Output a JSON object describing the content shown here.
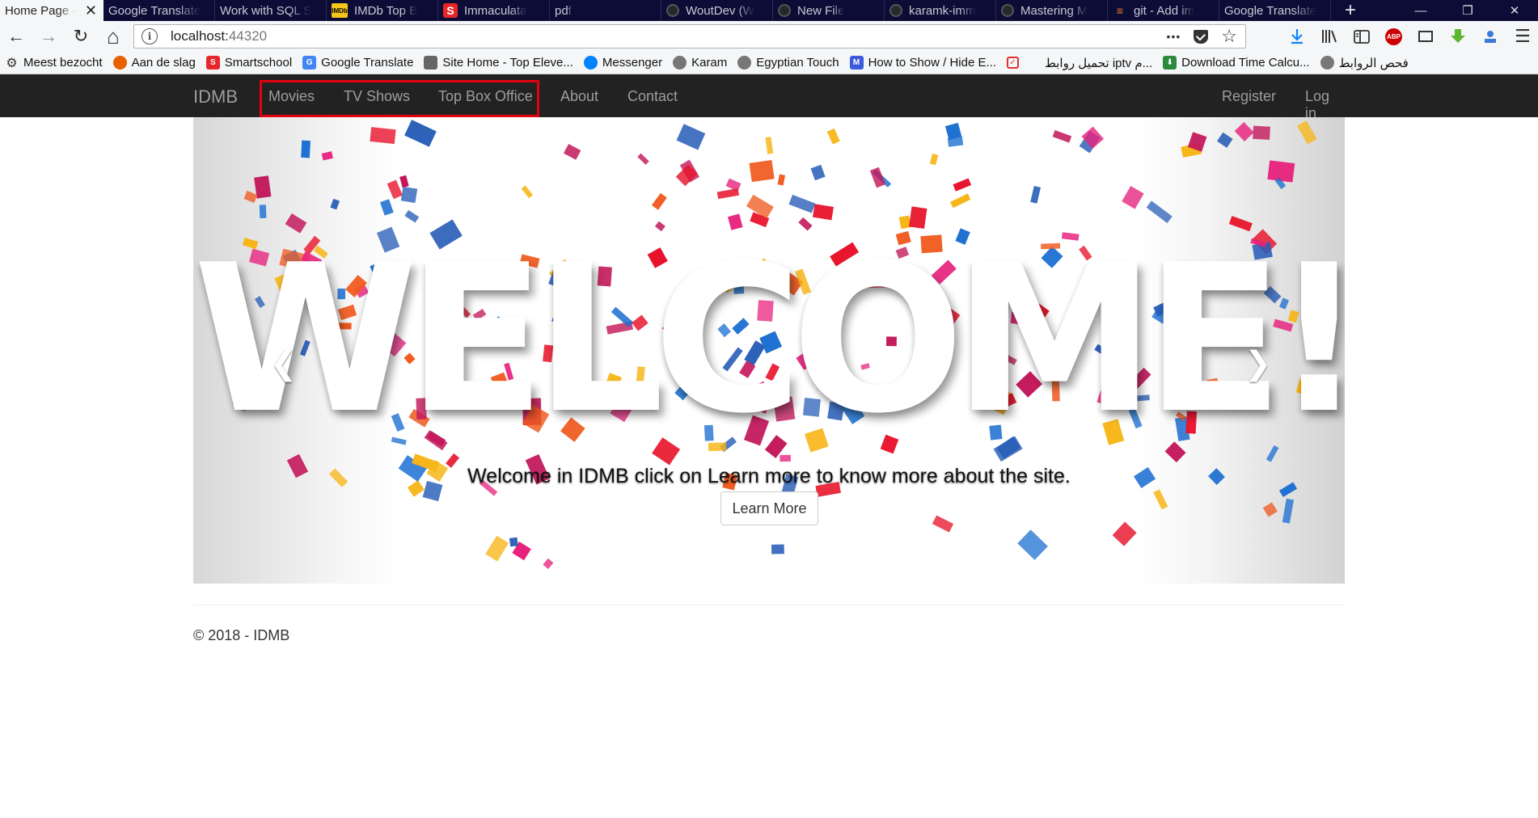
{
  "browser": {
    "tabs": [
      {
        "label": "Home Page - ",
        "icon": "none",
        "active": true
      },
      {
        "label": "Google Translate",
        "icon": "none"
      },
      {
        "label": "Work with SQL S",
        "icon": "none"
      },
      {
        "label": "IMDb Top B",
        "icon": "imdb",
        "icon_text": "IMDb"
      },
      {
        "label": "Immaculata",
        "icon": "smart",
        "icon_text": "S"
      },
      {
        "label": "pdf",
        "icon": "none"
      },
      {
        "label": "WoutDev (W",
        "icon": "gh"
      },
      {
        "label": "New File",
        "icon": "gh"
      },
      {
        "label": "karamk-imm",
        "icon": "gh"
      },
      {
        "label": "Mastering M",
        "icon": "gh"
      },
      {
        "label": "git - Add im",
        "icon": "so",
        "icon_text": "≡"
      },
      {
        "label": "Google Translate",
        "icon": "none"
      }
    ],
    "close_tab_glyph": "✕",
    "new_tab_glyph": "+",
    "window_controls": {
      "minimize": "—",
      "restore": "❐",
      "close": "✕"
    },
    "toolbar": {
      "back": "←",
      "forward": "→",
      "reload": "↻",
      "home": "⌂",
      "url_host": "localhost:",
      "url_port": "44320",
      "more": "•••",
      "star": "☆"
    },
    "bookmarks": [
      {
        "label": "Meest bezocht",
        "icon": "gear-icon",
        "color": "#333333",
        "glyph": "⚙"
      },
      {
        "label": "Aan de slag",
        "icon": "firefox-icon",
        "color": "#e66000",
        "glyph": ""
      },
      {
        "label": "Smartschool",
        "icon": "smartschool-icon",
        "color": "#e8262a",
        "glyph": "S"
      },
      {
        "label": "Google Translate",
        "icon": "translate-icon",
        "color": "#4285f4",
        "glyph": "G"
      },
      {
        "label": "Site Home - Top Eleve...",
        "icon": "site-icon",
        "color": "#666666",
        "glyph": ""
      },
      {
        "label": "Messenger",
        "icon": "messenger-icon",
        "color": "#0084ff",
        "glyph": ""
      },
      {
        "label": "Karam",
        "icon": "globe-icon",
        "color": "#777777",
        "glyph": ""
      },
      {
        "label": "Egyptian Touch",
        "icon": "globe-icon",
        "color": "#777777",
        "glyph": ""
      },
      {
        "label": "How to Show / Hide E...",
        "icon": "m-icon",
        "color": "#3b5bdb",
        "glyph": "M"
      },
      {
        "label": "",
        "icon": "checklist-icon",
        "color": "#e03131",
        "glyph": "✓"
      },
      {
        "label": "تحميل روابط iptv م...",
        "icon": "none",
        "color": "transparent",
        "glyph": ""
      },
      {
        "label": "Download Time Calcu...",
        "icon": "download-icon",
        "color": "#2b8a3e",
        "glyph": "⬇"
      },
      {
        "label": "فحص الروابط",
        "icon": "globe-icon",
        "color": "#777777",
        "glyph": ""
      }
    ]
  },
  "site": {
    "brand": "IDMB",
    "nav": {
      "movies": "Movies",
      "tv_shows": "TV Shows",
      "top_box_office": "Top Box Office",
      "about": "About",
      "contact": "Contact",
      "register": "Register",
      "login": "Log in"
    },
    "carousel": {
      "image_text": "WELCOME!",
      "caption": "Welcome in IDMB click on Learn more to know more about the site.",
      "button": "Learn More",
      "prev_glyph": "❮",
      "next_glyph": "❯"
    },
    "footer": "© 2018 - IDMB"
  },
  "colors": {
    "navbar_bg": "#222222",
    "nav_link": "#9d9d9d",
    "highlight_box": "#e3000f",
    "confetti": [
      "#e8132b",
      "#1c6fd1",
      "#f7b515",
      "#e7237d",
      "#f05a1e",
      "#2a5fb8",
      "#c2185b"
    ]
  }
}
